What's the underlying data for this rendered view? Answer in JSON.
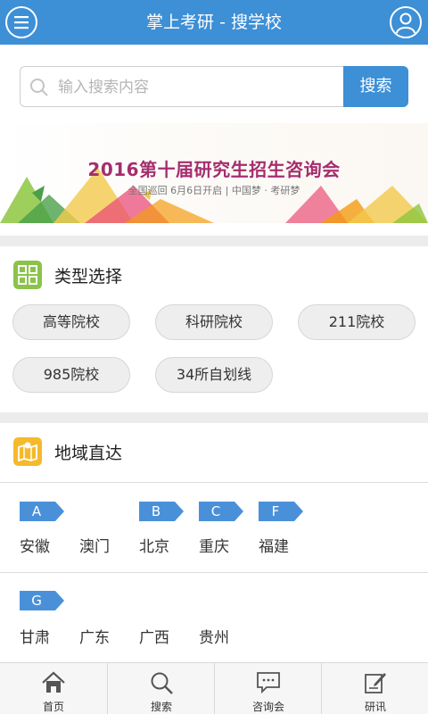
{
  "header": {
    "title": "掌上考研 - 搜学校",
    "menu_icon": "menu-icon",
    "user_icon": "user-icon"
  },
  "search": {
    "placeholder": "输入搜索内容",
    "value": "",
    "button_label": "搜索"
  },
  "banner": {
    "title": "2016第十届研究生招生咨询会",
    "subtitle": "全国巡回  6月6日开启 | 中国梦 · 考研梦"
  },
  "type_section": {
    "title": "类型选择",
    "chips": [
      "高等院校",
      "科研院校",
      "211院校",
      "985院校",
      "34所自划线"
    ]
  },
  "region_section": {
    "title": "地域直达",
    "letters": [
      "A",
      "B",
      "C",
      "F",
      "G"
    ],
    "regions_row1": [
      "安徽",
      "澳门",
      "北京",
      "重庆",
      "福建"
    ],
    "regions_row2": [
      "甘肃",
      "广东",
      "广西",
      "贵州"
    ]
  },
  "tabbar": {
    "tabs": [
      "首页",
      "搜索",
      "咨询会",
      "研讯"
    ]
  },
  "colors": {
    "primary": "#3d8fd6",
    "type_icon": "#8bc34a",
    "region_icon": "#f5b92c"
  }
}
